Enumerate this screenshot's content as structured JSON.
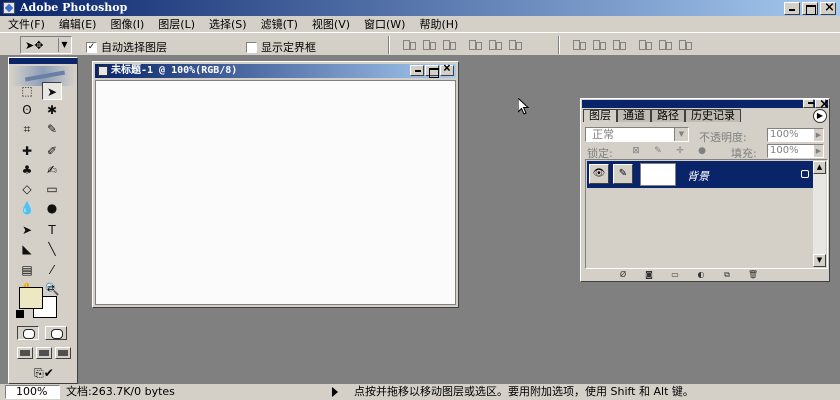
{
  "app": {
    "title": "Adobe Photoshop",
    "icon": "photoshop-app-icon"
  },
  "menubar": {
    "items": [
      "文件(F)",
      "编辑(E)",
      "图像(I)",
      "图层(L)",
      "选择(S)",
      "滤镜(T)",
      "视图(V)",
      "窗口(W)",
      "帮助(H)"
    ]
  },
  "options": {
    "auto_select_label": "自动选择图层",
    "auto_select_checked": "✓",
    "show_bounds_label": "显示定界框"
  },
  "document": {
    "title": "未标题-1 @ 100%(RGB/8)",
    "zoom": "100%",
    "doc_size": "文档:263.7K/0 bytes"
  },
  "colors": {
    "foreground": "#ede8c4",
    "background": "#ffffff",
    "title_start": "#0a246a",
    "title_end": "#a6caf0"
  },
  "layers_panel": {
    "tabs": [
      "图层",
      "通道",
      "路径",
      "历史记录"
    ],
    "blend_mode": "正常",
    "opacity_label": "不透明度:",
    "opacity_value": "100%",
    "lock_label": "锁定:",
    "fill_label": "填充:",
    "fill_value": "100%",
    "layer_name": "背景"
  },
  "status": {
    "hint": "点按并拖移以移动图层或选区。要用附加选项，使用 Shift 和 Alt 键。"
  }
}
